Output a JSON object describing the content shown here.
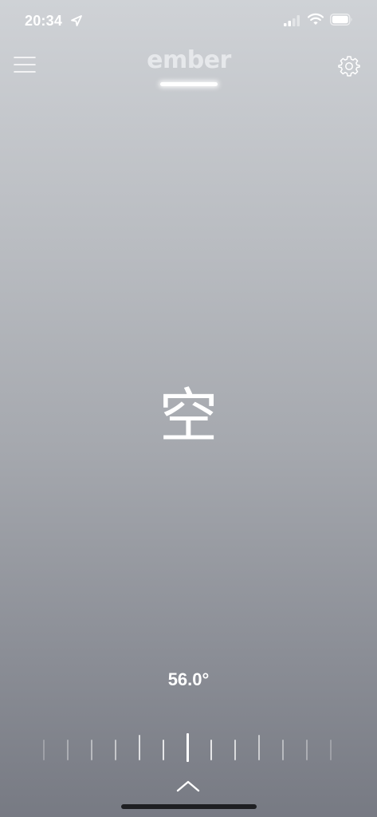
{
  "status_bar": {
    "time": "20:34",
    "icons": [
      "location-arrow-icon",
      "cellular-signal-icon",
      "wifi-icon",
      "battery-icon"
    ]
  },
  "header": {
    "logo": "ember",
    "menu_icon": "hamburger-menu-icon",
    "settings_icon": "gear-icon"
  },
  "main": {
    "status_word": "空",
    "temperature": "56.0°"
  },
  "controls": {
    "dial_icon": "temperature-dial",
    "expand_icon": "chevron-up-icon"
  },
  "colors": {
    "background_top": "#cfd2d6",
    "background_bottom": "#777a83",
    "text": "#ffffff",
    "home_indicator": "#1e1f22"
  }
}
